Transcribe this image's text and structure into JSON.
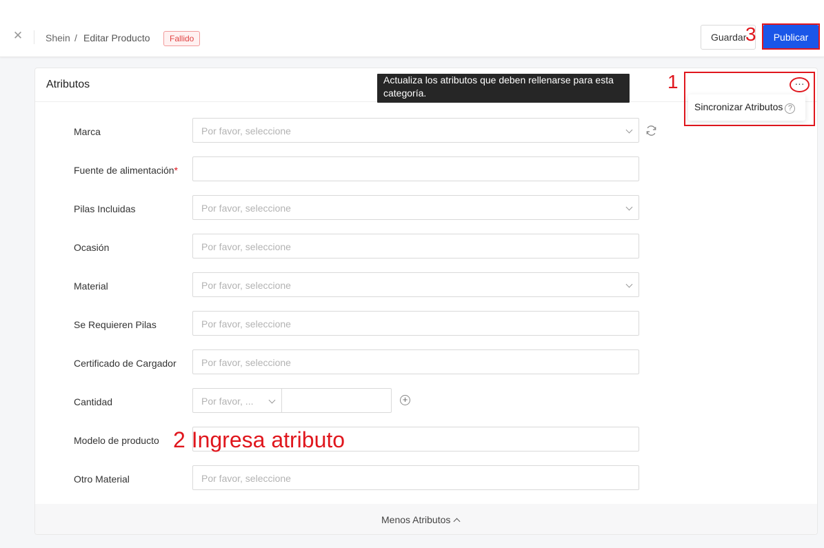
{
  "header": {
    "close_icon": "close-icon",
    "breadcrumb_store": "Shein",
    "breadcrumb_separator": "/",
    "page_title": "Editar Producto",
    "status_badge": "Fallido",
    "save_label": "Guardar",
    "publish_label": "Publicar"
  },
  "annotations": {
    "step1": "1",
    "step2": "2 Ingresa atributo",
    "step3": "3",
    "highlight_color": "#e0161d"
  },
  "section": {
    "title": "Atributos",
    "tooltip": "Actualiza los atributos que deben rellenarse para esta categoría.",
    "more_label": "···",
    "menu_item": "Sincronizar Atributos",
    "help_glyph": "?",
    "less_label": "Menos Atributos"
  },
  "fields": [
    {
      "label": "Marca",
      "placeholder": "Por favor, seleccione",
      "type": "select"
    },
    {
      "label": "Fuente de alimentación",
      "required": "*",
      "placeholder": "",
      "type": "input"
    },
    {
      "label": "Pilas Incluidas",
      "placeholder": "Por favor, seleccione",
      "type": "select"
    },
    {
      "label": "Ocasión",
      "placeholder": "Por favor, seleccione",
      "type": "input"
    },
    {
      "label": "Material",
      "placeholder": "Por favor, seleccione",
      "type": "select"
    },
    {
      "label": "Se Requieren Pilas",
      "placeholder": "Por favor, seleccione",
      "type": "input"
    },
    {
      "label": "Certificado de Cargador",
      "placeholder": "Por favor, seleccione",
      "type": "input"
    },
    {
      "label": "Cantidad",
      "placeholder": "Por favor, ...",
      "type": "quantity"
    },
    {
      "label": "Modelo de producto",
      "placeholder": "",
      "type": "input"
    },
    {
      "label": "Otro Material",
      "placeholder": "Por favor, seleccione",
      "type": "input"
    }
  ],
  "colors": {
    "primary": "#1a56e8",
    "danger": "#e0161d",
    "badge_bg": "#fff1f1"
  }
}
